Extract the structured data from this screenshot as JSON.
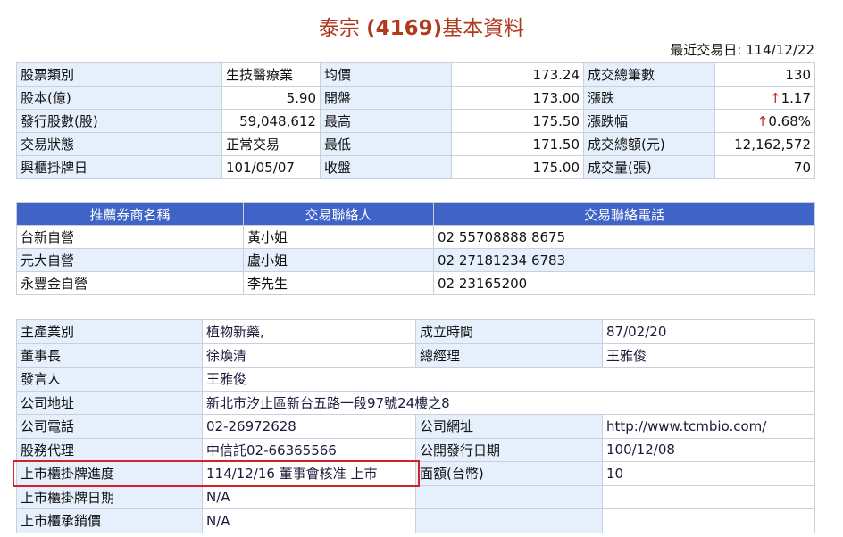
{
  "title": {
    "name": "泰宗 ",
    "code": "(4169)",
    "suffix": "基本資料"
  },
  "last_trade_date": "最近交易日: 114/12/22",
  "quote": {
    "rows": [
      [
        "股票類別",
        "生技醫療業",
        "均價",
        "173.24",
        "成交總筆數",
        "130"
      ],
      [
        "股本(億)",
        "5.90",
        "開盤",
        "173.00",
        "漲跌",
        "↑1.17"
      ],
      [
        "發行股數(股)",
        "59,048,612",
        "最高",
        "175.50",
        "漲跌幅",
        "↑0.68%"
      ],
      [
        "交易狀態",
        "正常交易",
        "最低",
        "171.50",
        "成交總額(元)",
        "12,162,572"
      ],
      [
        "興櫃掛牌日",
        "101/05/07",
        "收盤",
        "175.00",
        "成交量(張)",
        "70"
      ]
    ]
  },
  "brokers": {
    "headers": [
      "推薦券商名稱",
      "交易聯絡人",
      "交易聯絡電話"
    ],
    "rows": [
      [
        "台新自營",
        "黃小姐",
        "02 55708888 8675"
      ],
      [
        "元大自營",
        "盧小姐",
        "02 27181234 6783"
      ],
      [
        "永豐金自營",
        "李先生",
        "02 23165200"
      ]
    ]
  },
  "company": {
    "main_business": [
      "主產業別",
      "植物新藥,"
    ],
    "founded": [
      "成立時間",
      "87/02/20"
    ],
    "chairman": [
      "董事長",
      "徐煥清"
    ],
    "gm": [
      "總經理",
      "王雅俊"
    ],
    "spokesman": [
      "發言人",
      "王雅俊"
    ],
    "address": [
      "公司地址",
      "新北市汐止區新台五路一段97號24樓之8"
    ],
    "phone": [
      "公司電話",
      "02-26972628"
    ],
    "website": [
      "公司網址",
      "http://www.tcmbio.com/"
    ],
    "agent": [
      "股務代理",
      "中信託02-66365566"
    ],
    "public_date": [
      "公開發行日期",
      "100/12/08"
    ],
    "listing_progress": [
      "上市櫃掛牌進度",
      "114/12/16 董事會核准 上市"
    ],
    "par_value": [
      "面額(台幣)",
      "10"
    ],
    "listing_date": [
      "上市櫃掛牌日期",
      "N/A"
    ],
    "underwriting_price": [
      "上市櫃承銷價",
      "N/A"
    ]
  },
  "colors": {
    "accent": "#b03a20",
    "header": "#3f63c6",
    "label_bg": "#e6effc",
    "highlight": "#d2232a",
    "up": "#d02020"
  }
}
